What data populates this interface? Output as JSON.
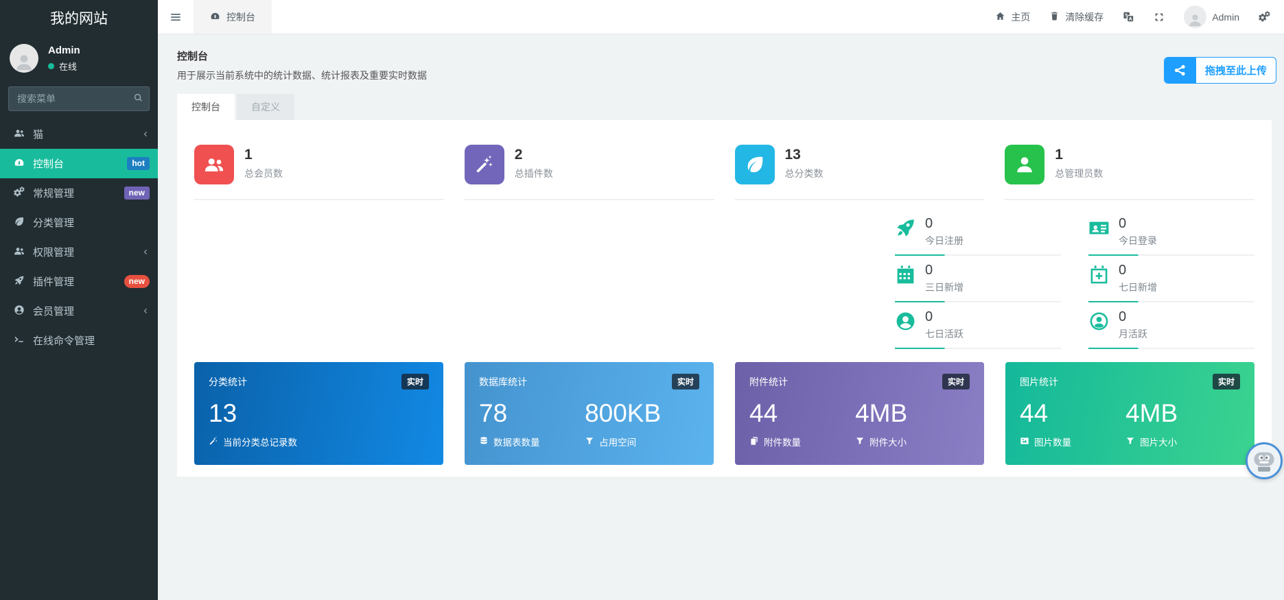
{
  "colors": {
    "accent_green": "#18bc9c",
    "badge_hot_blue": "#1d7fc1",
    "badge_new_purple": "#6f63b5",
    "badge_new_red": "#e8503f",
    "upload_blue": "#1E9FFF",
    "stat_red": "#f05050",
    "stat_purple": "#7266ba",
    "stat_cyan": "#23b7e5",
    "stat_green": "#27c24c",
    "card_blue_dark": "#0d6ebf",
    "card_blue_light": "#4f9fdd",
    "card_purple": "#7a6fb6",
    "card_green": "#1fc8a0"
  },
  "sidebar": {
    "site_title": "我的网站",
    "user": {
      "name": "Admin",
      "status": "在线"
    },
    "search_placeholder": "搜索菜单",
    "search_icon": "search-icon",
    "menu": [
      {
        "label": "猫",
        "icon": "users-icon",
        "chevron": "‹"
      },
      {
        "label": "控制台",
        "icon": "dashboard-icon",
        "badge": "hot",
        "active": true
      },
      {
        "label": "常规管理",
        "icon": "cogs-icon",
        "badge": "new"
      },
      {
        "label": "分类管理",
        "icon": "leaf-icon"
      },
      {
        "label": "权限管理",
        "icon": "users-icon",
        "chevron": "‹"
      },
      {
        "label": "插件管理",
        "icon": "rocket-icon",
        "badge": "new"
      },
      {
        "label": "会员管理",
        "icon": "user-circle-icon",
        "chevron": "‹"
      },
      {
        "label": "在线命令管理",
        "icon": "terminal-icon"
      }
    ]
  },
  "topbar": {
    "menu_icon": "hamburger-icon",
    "tab_label": "控制台",
    "tab_icon": "dashboard-icon",
    "home_label": "主页",
    "clear_cache_label": "清除缓存",
    "language_icon": "language-icon",
    "fullscreen_icon": "expand-icon",
    "username": "Admin",
    "settings_icon": "cogs-icon"
  },
  "content": {
    "title": "控制台",
    "subtitle": "用于展示当前系统中的统计数据、统计报表及重要实时数据",
    "upload_label": "拖拽至此上传",
    "upload_icon": "share-nodes-icon",
    "tabs": [
      {
        "label": "控制台",
        "active": true
      },
      {
        "label": "自定义",
        "active": false
      }
    ],
    "big_stats": [
      {
        "value": "1",
        "label": "总会员数",
        "icon": "users-icon",
        "color": "#f05050"
      },
      {
        "value": "2",
        "label": "总插件数",
        "icon": "magic-wand-icon",
        "color": "#7266ba"
      },
      {
        "value": "13",
        "label": "总分类数",
        "icon": "leaf-icon",
        "color": "#23b7e5"
      },
      {
        "value": "1",
        "label": "总管理员数",
        "icon": "user-icon",
        "color": "#27c24c"
      }
    ],
    "mini_stats": [
      {
        "value": "0",
        "label": "今日注册",
        "icon": "rocket-icon"
      },
      {
        "value": "0",
        "label": "今日登录",
        "icon": "id-card-icon"
      },
      {
        "value": "0",
        "label": "三日新增",
        "icon": "calendar-icon"
      },
      {
        "value": "0",
        "label": "七日新增",
        "icon": "calendar-plus-icon"
      },
      {
        "value": "0",
        "label": "七日活跃",
        "icon": "user-circle-icon"
      },
      {
        "value": "0",
        "label": "月活跃",
        "icon": "user-circle-outline-icon"
      }
    ],
    "cards": [
      {
        "title": "分类统计",
        "badge": "实时",
        "metrics": [
          {
            "value": "13",
            "label": "当前分类总记录数",
            "icon": "magic-wand-icon"
          }
        ]
      },
      {
        "title": "数据库统计",
        "badge": "实时",
        "metrics": [
          {
            "value": "78",
            "label": "数据表数量",
            "icon": "database-icon"
          },
          {
            "value": "800KB",
            "label": "占用空间",
            "icon": "filter-icon"
          }
        ]
      },
      {
        "title": "附件统计",
        "badge": "实时",
        "metrics": [
          {
            "value": "44",
            "label": "附件数量",
            "icon": "copy-icon"
          },
          {
            "value": "4MB",
            "label": "附件大小",
            "icon": "filter-icon"
          }
        ]
      },
      {
        "title": "图片统计",
        "badge": "实时",
        "metrics": [
          {
            "value": "44",
            "label": "图片数量",
            "icon": "image-icon"
          },
          {
            "value": "4MB",
            "label": "图片大小",
            "icon": "filter-icon"
          }
        ]
      }
    ]
  }
}
